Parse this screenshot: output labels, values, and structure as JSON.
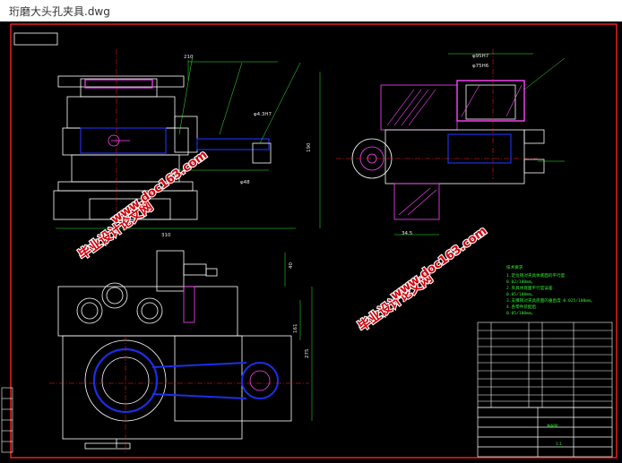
{
  "window": {
    "title": "珩磨大头孔夹具.dwg"
  },
  "dimensions": {
    "d210": "210",
    "d310": "310",
    "d40": "40",
    "d161": "161",
    "d275": "275",
    "d190": "190",
    "d34_5": "34.5",
    "tol1": "φ4.3H7",
    "tol2": "φ48",
    "tol3": "φ75H6",
    "tol4": "φ95H7"
  },
  "watermark": {
    "a": "毕业设计论文网",
    "b": "www.doc163.com"
  },
  "tech_notes": {
    "heading": "技术要求",
    "lines": [
      "1.定位销对夹具体底面的平行度",
      "0.02/100mm。",
      "2.夹具体底面平行度误差",
      "0.05/100mm。",
      "3.支撑销对夹具底面的垂直度 0.025/100mm。",
      "4.各零件装配后",
      "0.05/100mm。"
    ]
  },
  "title_block": {
    "drawing_name": "装配图",
    "scale": "1:1"
  },
  "colors": {
    "background": "#000000",
    "lines": "#ffffff",
    "hatch": "#ff44ff",
    "blue": "#1c2fe6",
    "green": "#33ee33",
    "red": "#ff2020",
    "watermark": "#d0000a"
  }
}
